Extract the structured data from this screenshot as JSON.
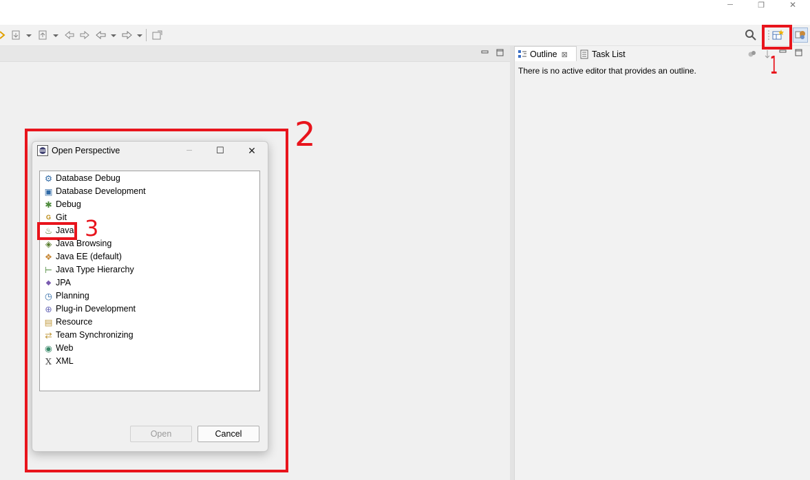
{
  "window": {
    "min_glyph": "─",
    "restore_glyph": "❐",
    "close_glyph": "✕"
  },
  "toolbar": {
    "search_glyph": "⚲",
    "icons": [
      "wizard-icon",
      "down-arrow-icon",
      "save-icon",
      "back-icon",
      "forward-icon",
      "history-icon",
      "pin-icon"
    ]
  },
  "outline_panel": {
    "tabs": [
      {
        "label": "Outline",
        "close": "⊠"
      },
      {
        "label": "Task List"
      }
    ],
    "message": "There is no active editor that provides an outline."
  },
  "dialog": {
    "title": "Open Perspective",
    "min_glyph": "─",
    "max_glyph": "☐",
    "close_glyph": "✕",
    "perspectives": [
      {
        "label": "Database Debug",
        "icon": "database-debug-icon",
        "glyph": "⚙"
      },
      {
        "label": "Database Development",
        "icon": "database-development-icon",
        "glyph": "▣"
      },
      {
        "label": "Debug",
        "icon": "bug-icon",
        "glyph": "✱"
      },
      {
        "label": "Git",
        "icon": "git-icon",
        "glyph": "G"
      },
      {
        "label": "Java",
        "icon": "java-icon",
        "glyph": "♨"
      },
      {
        "label": "Java Browsing",
        "icon": "java-browsing-icon",
        "glyph": "◈"
      },
      {
        "label": "Java EE (default)",
        "icon": "java-ee-icon",
        "glyph": "❖"
      },
      {
        "label": "Java Type Hierarchy",
        "icon": "type-hierarchy-icon",
        "glyph": "⊢"
      },
      {
        "label": "JPA",
        "icon": "jpa-icon",
        "glyph": "◆"
      },
      {
        "label": "Planning",
        "icon": "planning-icon",
        "glyph": "◷"
      },
      {
        "label": "Plug-in Development",
        "icon": "plugin-icon",
        "glyph": "⊕"
      },
      {
        "label": "Resource",
        "icon": "folder-icon",
        "glyph": "▤"
      },
      {
        "label": "Team Synchronizing",
        "icon": "team-sync-icon",
        "glyph": "⇄"
      },
      {
        "label": "Web",
        "icon": "globe-icon",
        "glyph": "◉"
      },
      {
        "label": "XML",
        "icon": "xml-icon",
        "glyph": "X"
      }
    ],
    "open_label": "Open",
    "cancel_label": "Cancel"
  },
  "annotations": {
    "label_1": "1",
    "label_2": "2",
    "label_3": "3",
    "color": "#e8141c"
  }
}
